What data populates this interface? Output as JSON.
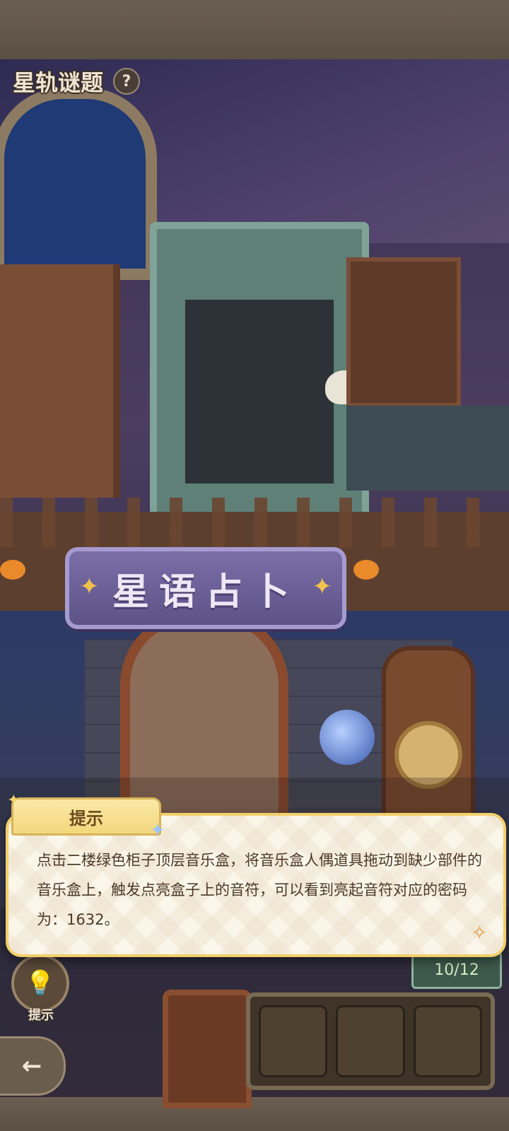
{
  "header": {
    "title": "星轨谜题",
    "help_icon": "question-icon",
    "help_label": "?"
  },
  "scene": {
    "sign_label": "星语占卜"
  },
  "hint_dialog": {
    "tab_label": "提示",
    "text": "点击二楼绿色柜子顶层音乐盒，将音乐盒人偶道具拖动到缺少部件的音乐盒上，触发点亮盒子上的音符，可以看到亮起音符对应的密码为：1632。",
    "corner_icon": "star-sparkle-icon"
  },
  "progress": {
    "value": "10/12"
  },
  "hint_button": {
    "icon": "lightbulb-icon",
    "label": "提示"
  },
  "back_button": {
    "icon": "arrow-left-icon"
  },
  "inventory": {
    "slot_count": 3
  },
  "colors": {
    "accent_gold": "#f2cf6b",
    "card_bg": "#fbf6ea",
    "text_brown": "#4c3a2a"
  }
}
